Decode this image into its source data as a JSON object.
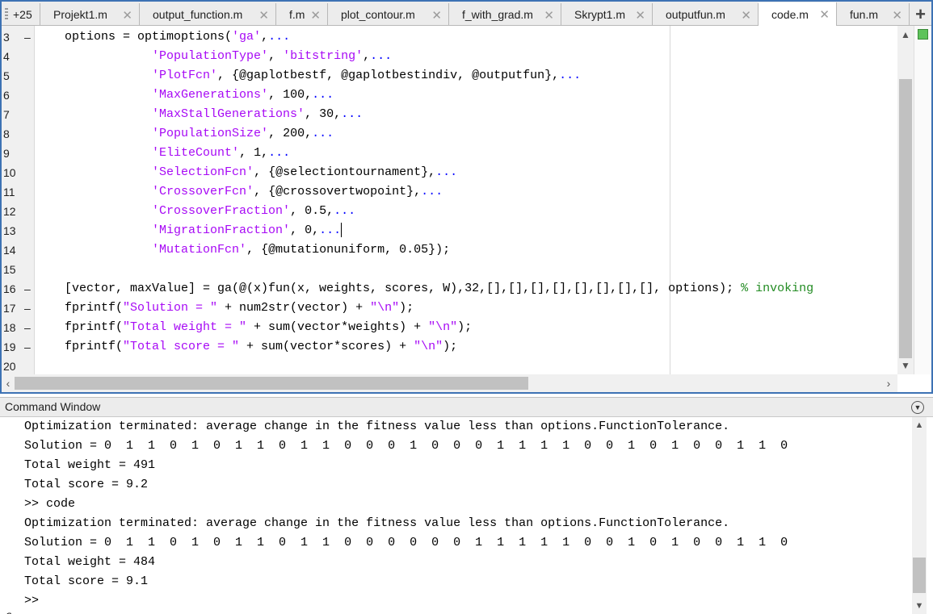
{
  "tabs": {
    "more_label": "+25",
    "items": [
      {
        "label": "Projekt1.m"
      },
      {
        "label": "output_function.m"
      },
      {
        "label": "f.m"
      },
      {
        "label": "plot_contour.m"
      },
      {
        "label": "f_with_grad.m"
      },
      {
        "label": "Skrypt1.m"
      },
      {
        "label": "outputfun.m"
      },
      {
        "label": "code.m",
        "active": true
      },
      {
        "label": "fun.m"
      }
    ],
    "close_glyph": "✕",
    "add_glyph": "+"
  },
  "editor": {
    "lines": [
      {
        "n": "3",
        "dash": "–",
        "segs": [
          [
            "",
            "options = optimoptions("
          ],
          [
            "str",
            "'ga'"
          ],
          [
            "",
            ","
          ],
          [
            "cont",
            "..."
          ]
        ]
      },
      {
        "n": "4",
        "dash": "",
        "segs": [
          [
            "",
            "            "
          ],
          [
            "str",
            "'PopulationType'"
          ],
          [
            "",
            ", "
          ],
          [
            "str",
            "'bitstring'"
          ],
          [
            "",
            ","
          ],
          [
            "cont",
            "..."
          ]
        ]
      },
      {
        "n": "5",
        "dash": "",
        "segs": [
          [
            "",
            "            "
          ],
          [
            "str",
            "'PlotFcn'"
          ],
          [
            "",
            ", {@gaplotbestf, @gaplotbestindiv, @outputfun},"
          ],
          [
            "cont",
            "..."
          ]
        ]
      },
      {
        "n": "6",
        "dash": "",
        "segs": [
          [
            "",
            "            "
          ],
          [
            "str",
            "'MaxGenerations'"
          ],
          [
            "",
            ", 100,"
          ],
          [
            "cont",
            "..."
          ]
        ]
      },
      {
        "n": "7",
        "dash": "",
        "segs": [
          [
            "",
            "            "
          ],
          [
            "str",
            "'MaxStallGenerations'"
          ],
          [
            "",
            ", 30,"
          ],
          [
            "cont",
            "..."
          ]
        ]
      },
      {
        "n": "8",
        "dash": "",
        "segs": [
          [
            "",
            "            "
          ],
          [
            "str",
            "'PopulationSize'"
          ],
          [
            "",
            ", 200,"
          ],
          [
            "cont",
            "..."
          ]
        ]
      },
      {
        "n": "9",
        "dash": "",
        "segs": [
          [
            "",
            "            "
          ],
          [
            "str",
            "'EliteCount'"
          ],
          [
            "",
            ", 1,"
          ],
          [
            "cont",
            "..."
          ]
        ]
      },
      {
        "n": "10",
        "dash": "",
        "segs": [
          [
            "",
            "            "
          ],
          [
            "str",
            "'SelectionFcn'"
          ],
          [
            "",
            ", {@selectiontournament},"
          ],
          [
            "cont",
            "..."
          ]
        ]
      },
      {
        "n": "11",
        "dash": "",
        "segs": [
          [
            "",
            "            "
          ],
          [
            "str",
            "'CrossoverFcn'"
          ],
          [
            "",
            ", {@crossovertwopoint},"
          ],
          [
            "cont",
            "..."
          ]
        ]
      },
      {
        "n": "12",
        "dash": "",
        "segs": [
          [
            "",
            "            "
          ],
          [
            "str",
            "'CrossoverFraction'"
          ],
          [
            "",
            ", 0.5,"
          ],
          [
            "cont",
            "..."
          ]
        ]
      },
      {
        "n": "13",
        "dash": "",
        "segs": [
          [
            "",
            "            "
          ],
          [
            "str",
            "'MigrationFraction'"
          ],
          [
            "",
            ", 0,"
          ],
          [
            "cont",
            "..."
          ],
          [
            "cursor",
            ""
          ]
        ]
      },
      {
        "n": "14",
        "dash": "",
        "segs": [
          [
            "",
            "            "
          ],
          [
            "str",
            "'MutationFcn'"
          ],
          [
            "",
            ", {@mutationuniform, 0.05});"
          ]
        ]
      },
      {
        "n": "15",
        "dash": "",
        "segs": [
          [
            "",
            ""
          ]
        ]
      },
      {
        "n": "16",
        "dash": "–",
        "segs": [
          [
            "",
            "[vector, maxValue] = ga(@(x)fun(x, weights, scores, W),32,[],[],[],[],[],[],[],[], options); "
          ],
          [
            "cmt",
            "% invoking"
          ]
        ]
      },
      {
        "n": "17",
        "dash": "–",
        "segs": [
          [
            "",
            "fprintf("
          ],
          [
            "str",
            "\"Solution = \""
          ],
          [
            "",
            " + num2str(vector) + "
          ],
          [
            "str",
            "\"\\n\""
          ],
          [
            "",
            ");"
          ]
        ]
      },
      {
        "n": "18",
        "dash": "–",
        "segs": [
          [
            "",
            "fprintf("
          ],
          [
            "str",
            "\"Total weight = \""
          ],
          [
            "",
            " + sum(vector*weights) + "
          ],
          [
            "str",
            "\"\\n\""
          ],
          [
            "",
            ");"
          ]
        ]
      },
      {
        "n": "19",
        "dash": "–",
        "segs": [
          [
            "",
            "fprintf("
          ],
          [
            "str",
            "\"Total score = \""
          ],
          [
            "",
            " + sum(vector*scores) + "
          ],
          [
            "str",
            "\"\\n\""
          ],
          [
            "",
            ");"
          ]
        ]
      },
      {
        "n": "20",
        "dash": "",
        "segs": [
          [
            "",
            ""
          ]
        ]
      }
    ]
  },
  "command_window": {
    "title": "Command Window",
    "lines": [
      "Optimization terminated: average change in the fitness value less than options.FunctionTolerance.",
      "Solution = 0  1  1  0  1  0  1  1  0  1  1  0  0  0  1  0  0  0  1  1  1  1  0  0  1  0  1  0  0  1  1  0",
      "Total weight = 491",
      "Total score = 9.2",
      ">> code",
      "Optimization terminated: average change in the fitness value less than options.FunctionTolerance.",
      "Solution = 0  1  1  0  1  0  1  1  0  1  1  0  0  0  0  0  0  1  1  1  1  1  0  0  1  0  1  0  0  1  1  0",
      "Total weight = 484",
      "Total score = 9.1",
      ">> "
    ],
    "fx_label": "fx"
  },
  "icons": {
    "scroll_up": "▲",
    "scroll_down": "▼",
    "scroll_left": "‹",
    "scroll_right": "›",
    "menu": "▼"
  }
}
